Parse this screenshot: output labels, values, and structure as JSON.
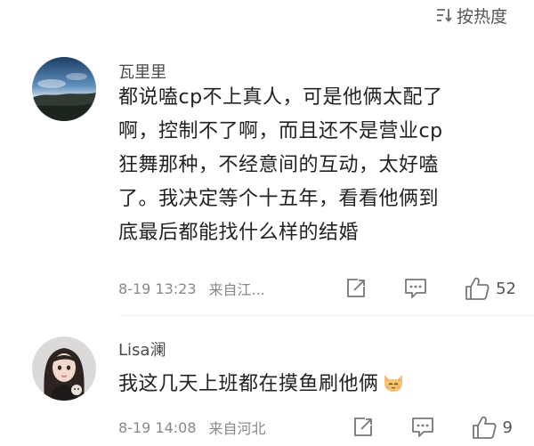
{
  "sort": {
    "label": "按热度",
    "icon": "sort-icon"
  },
  "comments": [
    {
      "username": "瓦里里",
      "lines": [
        "都说嗑cp不上真人，可是他俩太配了",
        "啊，控制不了啊，而且还不是营业cp",
        "狂舞那种，不经意间的互动，太好嗑",
        "了。我决定等个十五年，看看他俩到",
        "底最后都能找什么样的结婚"
      ],
      "time": "8-19 13:23",
      "location": "来自江...",
      "likes": "52",
      "avatar": "landscape-avatar"
    },
    {
      "username": "Lisa澜",
      "text": "我这几天上班都在摸鱼刷他俩",
      "emoji": "cat-emoji",
      "time": "8-19 14:08",
      "location": "来自河北",
      "likes": "9",
      "avatar": "girl-avatar"
    }
  ]
}
